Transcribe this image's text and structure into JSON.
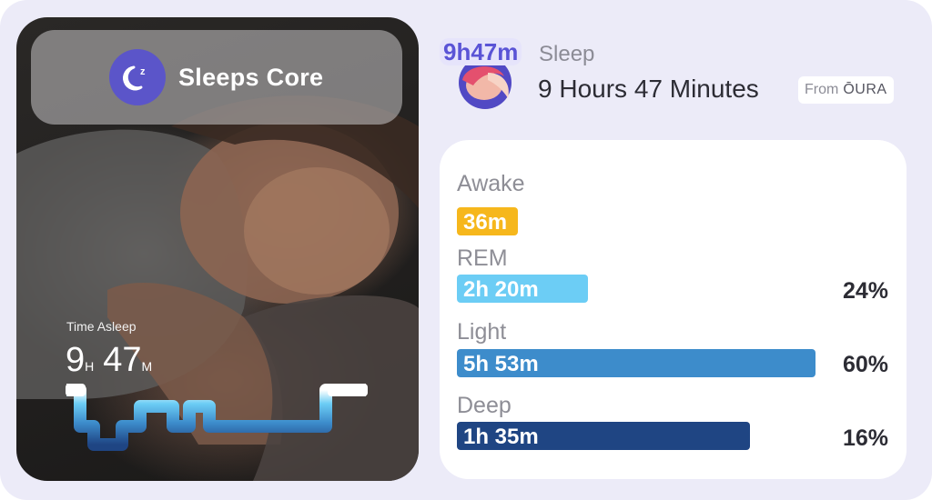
{
  "app": {
    "name": "Sleeps Core",
    "icon": "moon-zzz-icon",
    "brand_color": "#5b55c9"
  },
  "time_asleep": {
    "label": "Time Asleep",
    "hours": "9",
    "hours_unit": "H",
    "minutes": "47",
    "minutes_unit": "M"
  },
  "header": {
    "badge": "9h47m",
    "label": "Sleep",
    "duration": "9 Hours 47 Minutes",
    "source_prefix": "From",
    "source_brand": "ŌURA"
  },
  "stages": [
    {
      "name": "Awake",
      "duration": "36m",
      "fraction": 0.14,
      "percent": "",
      "color": "#f6b71c"
    },
    {
      "name": "REM",
      "duration": "2h 20m",
      "fraction": 0.3,
      "percent": "24%",
      "color": "#6ccdf5"
    },
    {
      "name": "Light",
      "duration": "5h 53m",
      "fraction": 0.82,
      "percent": "60%",
      "color": "#3d8ccb"
    },
    {
      "name": "Deep",
      "duration": "1h 35m",
      "fraction": 0.67,
      "percent": "16%",
      "color": "#1f4583"
    }
  ]
}
